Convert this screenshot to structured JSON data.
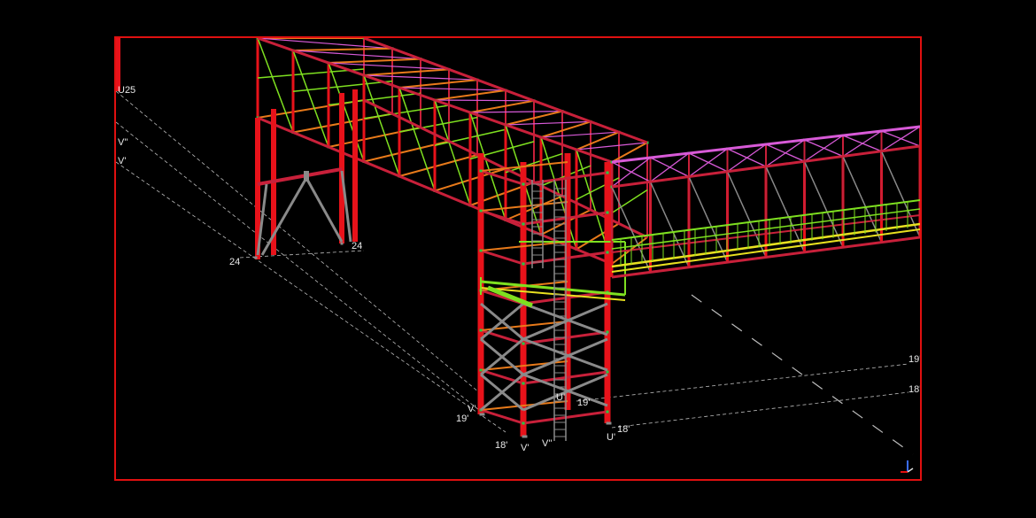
{
  "viewport": {
    "frame_color": "#e01010",
    "background": "#000000"
  },
  "palette": {
    "column": "#e8121a",
    "beam": "#c8203a",
    "floor_beam": "#e87a1a",
    "brace_green": "#7ee020",
    "brace_magenta": "#d85ad8",
    "bracing_grey": "#8a8a8a",
    "stud": "#22cc44",
    "grid_line": "#bdbdbd",
    "walkway_yellow": "#e8e020"
  },
  "grid_labels": [
    {
      "id": "u25",
      "text": "U25"
    },
    {
      "id": "v2",
      "text": "V''"
    },
    {
      "id": "v1",
      "text": "V'"
    },
    {
      "id": "g24a",
      "text": "24"
    },
    {
      "id": "g24b",
      "text": "24"
    },
    {
      "id": "g19a",
      "text": "19'"
    },
    {
      "id": "v1b",
      "text": "V'"
    },
    {
      "id": "g19b",
      "text": "19'"
    },
    {
      "id": "u1",
      "text": "U'"
    },
    {
      "id": "g18a",
      "text": "18'"
    },
    {
      "id": "v1c",
      "text": "V'"
    },
    {
      "id": "v2b",
      "text": "V''"
    },
    {
      "id": "g18b",
      "text": "18'"
    },
    {
      "id": "u2",
      "text": "U'"
    },
    {
      "id": "g19c",
      "text": "19'"
    },
    {
      "id": "g18c",
      "text": "18'"
    }
  ],
  "axis_icon": "axis-tripod-icon"
}
